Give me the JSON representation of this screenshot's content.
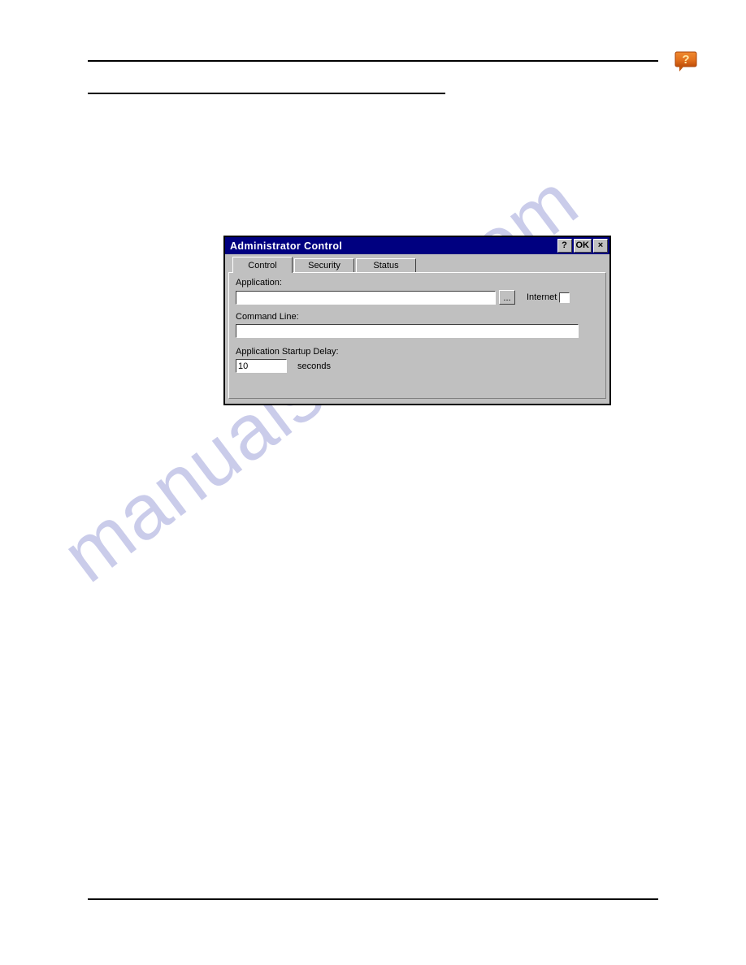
{
  "page": {
    "watermark_text": "manualshive.com",
    "watermark_color": "#b9bce3"
  },
  "header": {
    "help_icon": "help-bubble-icon",
    "help_icon_glyph": "?",
    "help_icon_color": "#e8701a"
  },
  "dialog": {
    "title": "Administrator Control",
    "title_bar_color": "#000080",
    "face_color": "#c0c0c0",
    "buttons": {
      "help_label": "?",
      "ok_label": "OK",
      "close_label": "×"
    },
    "tabs": [
      {
        "label": "Control",
        "active": true
      },
      {
        "label": "Security",
        "active": false
      },
      {
        "label": "Status",
        "active": false
      }
    ],
    "control_tab": {
      "application_label": "Application:",
      "application_value": "",
      "browse_label": "...",
      "internet_label": "Internet",
      "internet_checked": false,
      "command_line_label": "Command Line:",
      "command_line_value": "",
      "startup_delay_label": "Application Startup Delay:",
      "startup_delay_value": "10",
      "seconds_label": "seconds"
    }
  }
}
